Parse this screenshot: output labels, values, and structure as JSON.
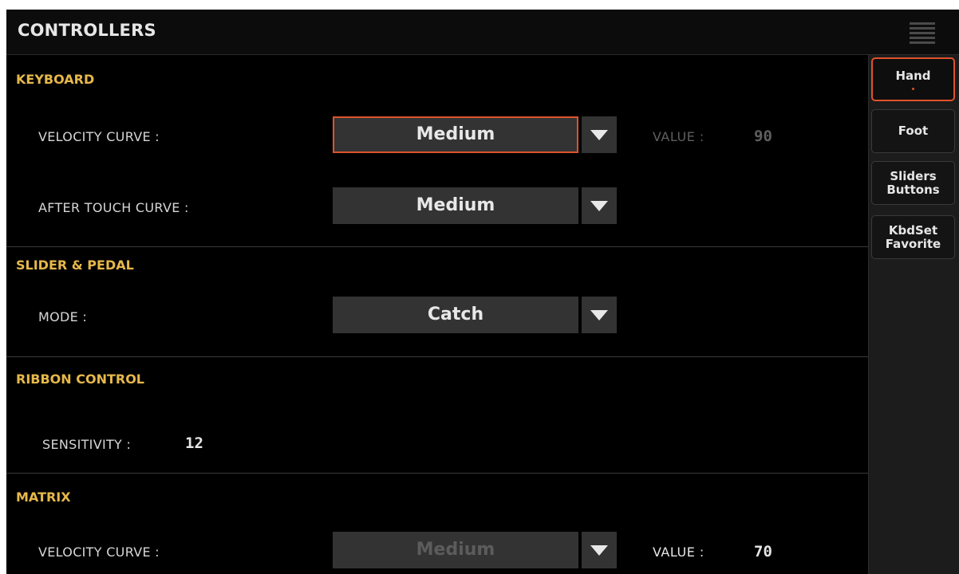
{
  "header": {
    "title": "CONTROLLERS",
    "menu_icon": "hamburger-menu-icon"
  },
  "keyboard": {
    "heading": "KEYBOARD",
    "velocity_curve": {
      "label": "VELOCITY CURVE :",
      "value": "Medium",
      "value_label": "VALUE :",
      "value_number": "90"
    },
    "after_touch_curve": {
      "label": "AFTER TOUCH CURVE :",
      "value": "Medium"
    }
  },
  "slider_pedal": {
    "heading": "SLIDER & PEDAL",
    "mode": {
      "label": "MODE :",
      "value": "Catch"
    }
  },
  "ribbon_control": {
    "heading": "RIBBON CONTROL",
    "sensitivity": {
      "label": "SENSITIVITY :",
      "value": "12"
    }
  },
  "matrix": {
    "heading": "MATRIX",
    "velocity_curve": {
      "label": "VELOCITY CURVE :",
      "value": "Medium",
      "value_label": "VALUE :",
      "value_number": "70"
    }
  },
  "tabs": {
    "hand": {
      "line1": "Hand"
    },
    "foot": {
      "line1": "Foot"
    },
    "sliders_buttons": {
      "line1": "Sliders",
      "line2": "Buttons"
    },
    "kbdset_favorite": {
      "line1": "KbdSet",
      "line2": "Favorite"
    }
  },
  "colors": {
    "accent": "#e0522c",
    "section_heading": "#e6b84a",
    "background": "#000000"
  }
}
